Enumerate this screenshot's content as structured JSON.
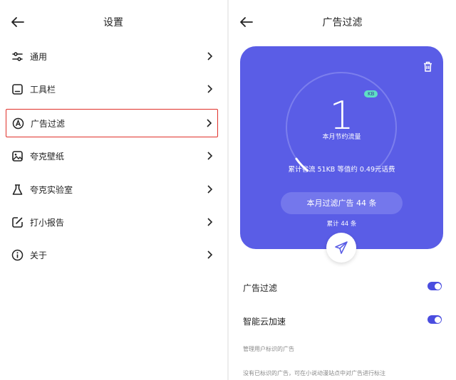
{
  "left": {
    "title": "设置",
    "menu": [
      {
        "label": "通用",
        "icon": "sliders-icon"
      },
      {
        "label": "工具栏",
        "icon": "toolbar-icon"
      },
      {
        "label": "广告过滤",
        "icon": "ad-filter-icon",
        "selected": true
      },
      {
        "label": "夸克壁纸",
        "icon": "wallpaper-icon"
      },
      {
        "label": "夸克实验室",
        "icon": "flask-icon"
      },
      {
        "label": "打小报告",
        "icon": "report-icon"
      },
      {
        "label": "关于",
        "icon": "info-icon"
      }
    ]
  },
  "right": {
    "title": "广告过滤",
    "card": {
      "amount": "1",
      "unit": "KB",
      "amount_label": "本月节约流量",
      "summary": "累计省流 51KB 等值约 0.49元话费",
      "pill_label": "本月过滤广告 44 条",
      "total": "累计 44 条",
      "gauge_fraction": 0.06
    },
    "settings": [
      {
        "label": "广告过滤",
        "enabled": true
      },
      {
        "label": "智能云加速",
        "enabled": true
      }
    ],
    "manage_label": "管理用户标识的广告",
    "empty_note": "没有已标识的广告，可在小说动漫站点中对广告进行标注"
  },
  "colors": {
    "card": "#5a5de6",
    "accent": "#4a4ddf",
    "kb_badge": "#5ee0c4",
    "highlight": "#e0302a"
  }
}
